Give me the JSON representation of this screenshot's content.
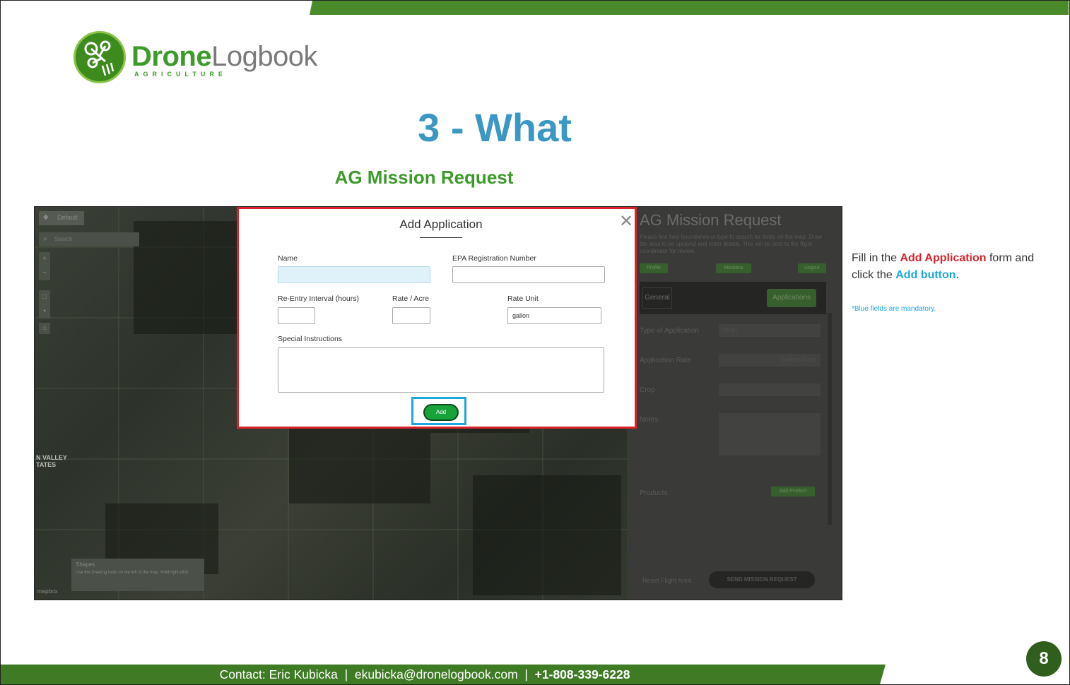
{
  "logo": {
    "brand_bold": "Drone",
    "brand_light": "Logbook",
    "tagline": "AGRICULTURE"
  },
  "slide": {
    "title": "3 - What",
    "subtitle": "AG Mission Request"
  },
  "screenshot": {
    "map": {
      "layer_button": "Default",
      "search_placeholder": "Search",
      "zoom_in": "+",
      "zoom_out": "−",
      "location_label_line1": "N VALLEY",
      "location_label_line2": "TATES",
      "shapes_tip_title": "Shapes",
      "shapes_tip_text": "Use the Drawing tools on the left of the map. Hold right-click",
      "attribution": "mapbox"
    },
    "panel": {
      "title": "AG Mission Request",
      "description": "Please find field boundaries or type to search for fields on the map. Draw the area to be sprayed and enter details. This will be sent to the flight coordinator for review.",
      "buttons": [
        "Profile",
        "Missions",
        "Logout"
      ],
      "tab_general": "General",
      "tab_applications": "Applications",
      "fields": [
        {
          "label": "Type of Application",
          "value": "Other"
        },
        {
          "label": "Application Rate",
          "value": "Gallons/Acre"
        },
        {
          "label": "Crop",
          "value": ""
        },
        {
          "label": "Notes",
          "value": ""
        }
      ],
      "products_label": "Products",
      "add_product_button": "Add Product",
      "reset_label": "Reset Flight Area",
      "send_button": "SEND MISSION REQUEST"
    },
    "modal": {
      "title": "Add Application",
      "close": "✕",
      "name_label": "Name",
      "name_value": "",
      "epa_label": "EPA Registration Number",
      "epa_value": "",
      "reentry_label": "Re-Entry Interval (hours)",
      "reentry_value": "",
      "rate_label": "Rate / Acre",
      "rate_value": "",
      "rate_unit_label": "Rate Unit",
      "rate_unit_value": "gallon",
      "special_label": "Special Instructions",
      "special_value": "",
      "add_button": "Add"
    }
  },
  "side_note": {
    "prefix": "Fill in the ",
    "highlight1": "Add Application",
    "middle": " form and click the ",
    "highlight2": "Add button",
    "suffix": ".",
    "mandatory": "*Blue fields are mandatory."
  },
  "footer": {
    "contact": "Contact: Eric Kubicka  |  ekubicka@dronelogbook.com  |  ",
    "phone": "+1-808-339-6228"
  },
  "page_number": "8",
  "colors": {
    "brand_green": "#3d9b2a",
    "title_blue": "#3b97c4",
    "highlight_red": "#d9242c",
    "highlight_blue": "#1ea6e0",
    "footer_green": "#3f7b25"
  }
}
